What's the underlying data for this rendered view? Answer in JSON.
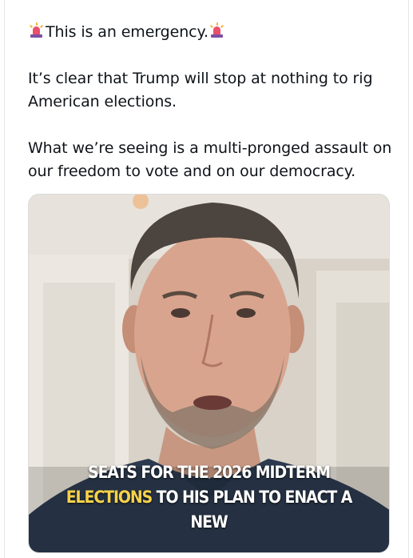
{
  "post": {
    "headline": "This is an emergency.",
    "paragraph_1": "It’s clear that Trump will stop at nothing to rig American elections.",
    "paragraph_2": "What we’re seeing is a multi-pronged assault on our freedom to vote and on our democracy.",
    "emoji_icon": "police-car-light-icon"
  },
  "video": {
    "caption_line_1": "SEATS FOR THE 2026 MIDTERM",
    "caption_line_2_highlight": "ELECTIONS",
    "caption_line_2_rest": " TO HIS PLAN TO ENACT A NEW",
    "highlight_color": "#f6d24a",
    "caption_color": "#ffffff"
  }
}
